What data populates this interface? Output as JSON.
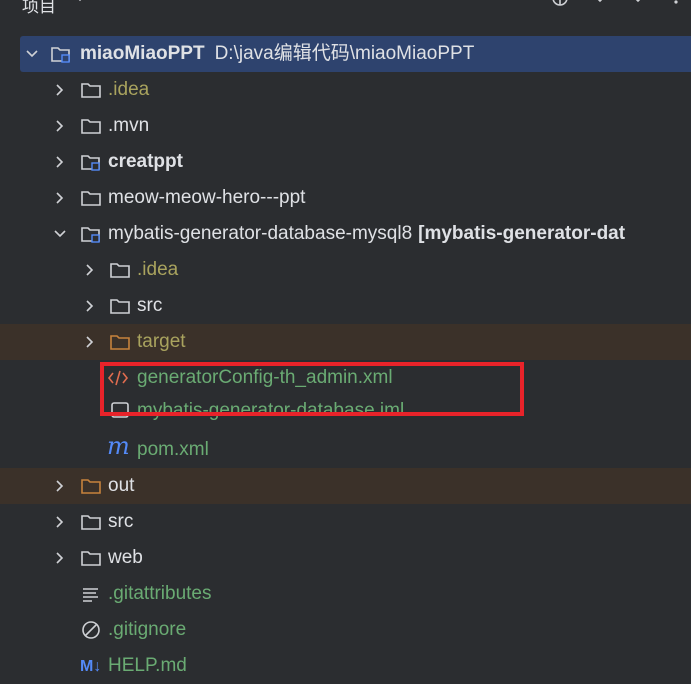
{
  "header": {
    "title": "项目"
  },
  "tree": {
    "rows": [
      {
        "label": "miaoMiaoPPT",
        "path": "D:\\java编辑代码\\miaoMiaoPPT"
      },
      {
        "label": ".idea"
      },
      {
        "label": ".mvn"
      },
      {
        "label": "creatppt"
      },
      {
        "label": "meow-meow-hero---ppt"
      },
      {
        "label": "mybatis-generator-database-mysql8",
        "suffix": "[mybatis-generator-dat"
      },
      {
        "label": ".idea"
      },
      {
        "label": "src"
      },
      {
        "label": "target"
      },
      {
        "label": "generatorConfig-th_admin.xml"
      },
      {
        "label": "mybatis-generator-database.iml"
      },
      {
        "label": "pom.xml"
      },
      {
        "label": "out"
      },
      {
        "label": "src"
      },
      {
        "label": "web"
      },
      {
        "label": ".gitattributes"
      },
      {
        "label": ".gitignore"
      },
      {
        "label": "HELP.md"
      }
    ]
  },
  "colors": {
    "background": "#2b2d30",
    "selection": "#2e436e",
    "excluded": "#3b3129",
    "highlight_box": "#e8232a"
  }
}
